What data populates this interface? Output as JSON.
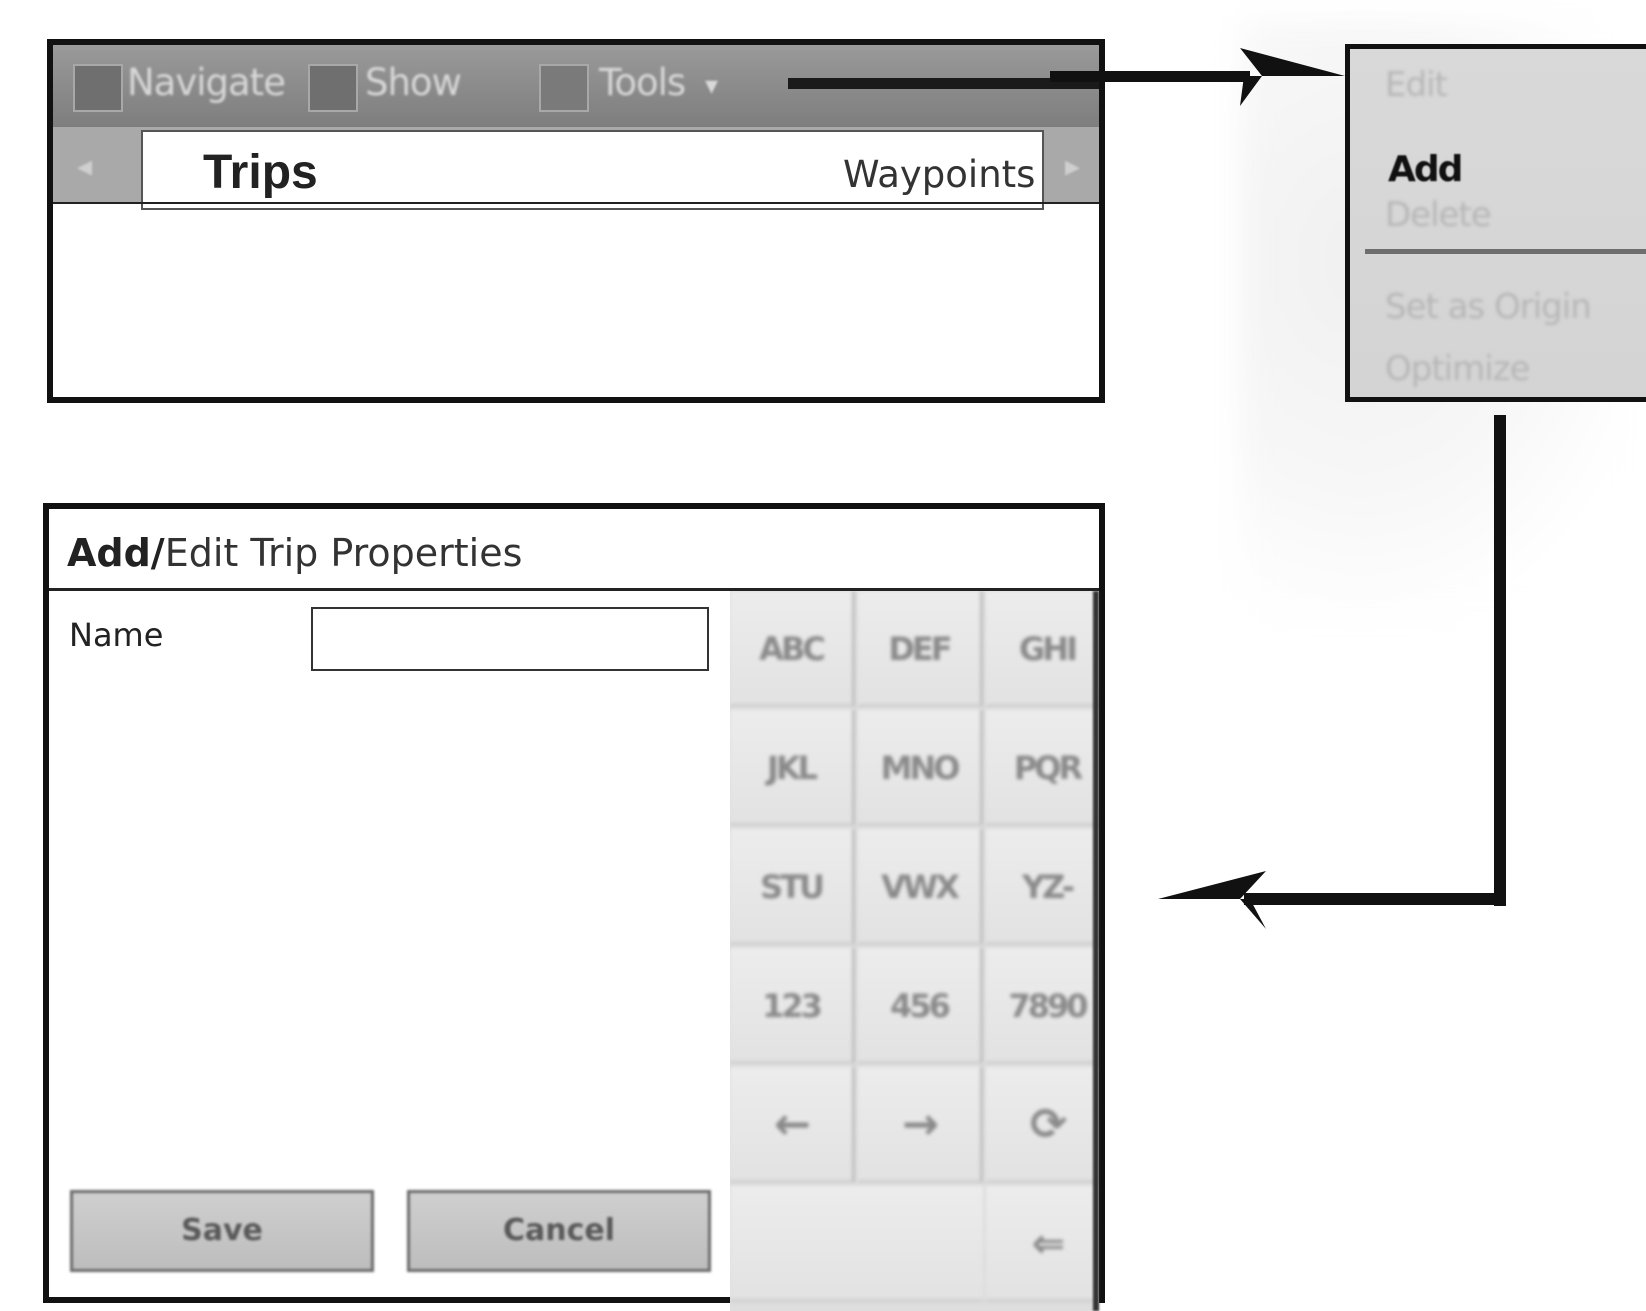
{
  "trips_screen": {
    "toolbar": {
      "navigate_label": "Navigate",
      "show_label": "Show",
      "tools_label": "Tools",
      "tools_caret": "▾"
    },
    "tabs": {
      "left_arrow": "◂",
      "active_tab": "Trips",
      "next_tab": "Waypoints",
      "right_arrow": "▸"
    }
  },
  "context_menu": {
    "items": [
      {
        "label": "Edit",
        "enabled": false
      },
      {
        "label": "Add",
        "enabled": true
      },
      {
        "label": "Delete",
        "enabled": false
      },
      {
        "label": "Set as Origin",
        "enabled": false
      },
      {
        "label": "Optimize",
        "enabled": false
      }
    ]
  },
  "dialog": {
    "title_bold": "Add/",
    "title_rest": "Edit Trip Properties",
    "name_label": "Name",
    "name_value": "",
    "save_label": "Save",
    "cancel_label": "Cancel",
    "keypad": {
      "rows": [
        [
          "ABC",
          "DEF",
          "GHI"
        ],
        [
          "JKL",
          "MNO",
          "PQR"
        ],
        [
          "STU",
          "VWX",
          "YZ-"
        ],
        [
          "123",
          "456",
          "7890"
        ],
        [
          "←",
          "→",
          "⟳"
        ],
        [
          "",
          "",
          "⇐"
        ]
      ]
    }
  },
  "colors": {
    "frame": "#111111",
    "toolbar": "#8a8a8a",
    "menu_bg": "#d6d6d6",
    "keypad_bg": "#e6e6e6"
  }
}
